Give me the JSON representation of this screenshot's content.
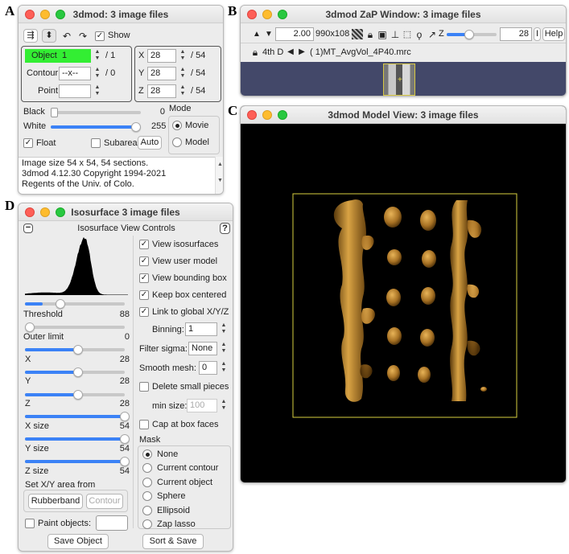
{
  "letters": {
    "a": "A",
    "b": "B",
    "c": "C",
    "d": "D"
  },
  "win_a": {
    "title": "3dmod: 3 image files",
    "show_label": "Show",
    "object_label": "Object",
    "object_value": "1",
    "object_total": "/ 1",
    "contour_label": "Contour",
    "contour_value": "--x--",
    "contour_total": "/ 0",
    "point_label": "Point",
    "x_label": "X",
    "x_value": "28",
    "x_total": "/ 54",
    "y_label": "Y",
    "y_value": "28",
    "y_total": "/ 54",
    "z_label": "Z",
    "z_value": "28",
    "z_total": "/ 54",
    "black_label": "Black",
    "black_value": "0",
    "black_level": 0,
    "white_label": "White",
    "white_value": "255",
    "white_level": 255,
    "mode_label": "Mode",
    "movie_label": "Movie",
    "model_label": "Model",
    "float_label": "Float",
    "subarea_label": "Subarea",
    "auto_label": "Auto",
    "info_lines": [
      "Image size 54 x 54, 54 sections.",
      "3dmod 4.12.30 Copyright 1994-2021",
      "Regents of the Univ. of Colo."
    ]
  },
  "win_b": {
    "title": "3dmod ZaP Window: 3 image files",
    "zoom_value": "2.00",
    "size_text": "990x108",
    "z_label": "Z",
    "z_value": "28",
    "help_label": "Help",
    "fourth_d_label": "4th D",
    "file_text": "( 1)MT_AvgVol_4P40.mrc"
  },
  "win_c": {
    "title": "3dmod Model View:  3 image files"
  },
  "win_d": {
    "title": "Isosurface 3 image files",
    "header": "Isosurface View Controls",
    "help_q": "?",
    "threshold_label": "Threshold",
    "threshold_value": "88",
    "threshold_level": 0.18,
    "outer_label": "Outer limit",
    "outer_value": "0",
    "outer_level": 0,
    "x_label": "X",
    "x_value": "28",
    "y_label": "Y",
    "y_value": "28",
    "z_label": "Z",
    "z_value": "28",
    "xsize_label": "X size",
    "xsize_value": "54",
    "ysize_label": "Y size",
    "ysize_value": "54",
    "zsize_label": "Z size",
    "zsize_value": "54",
    "setxy_label": "Set X/Y area from",
    "rubberband_label": "Rubberband",
    "contour_label": "Contour",
    "paint_label": "Paint objects:",
    "view_iso": "View isosurfaces",
    "view_model": "View user model",
    "view_box": "View bounding box",
    "keep_centered": "Keep box centered",
    "link_global": "Link to global X/Y/Z",
    "binning_label": "Binning:",
    "binning_value": "1",
    "filter_label": "Filter sigma:",
    "filter_value": "None",
    "smooth_label": "Smooth mesh:",
    "smooth_value": "0",
    "delete_small": "Delete small pieces",
    "minsize_label": "min size:",
    "minsize_value": "100",
    "cap_label": "Cap at box faces",
    "mask_label": "Mask",
    "mask_options": [
      "None",
      "Current contour",
      "Current object",
      "Sphere",
      "Ellipsoid",
      "Zap lasso"
    ],
    "save_object": "Save Object",
    "sort_save": "Sort & Save"
  },
  "colors": {
    "object_green": "#33ee33",
    "slider_blue": "#3b82f6",
    "gold": "#b07c24",
    "model_bg": "#000000",
    "box_yellow": "#d8d040"
  }
}
